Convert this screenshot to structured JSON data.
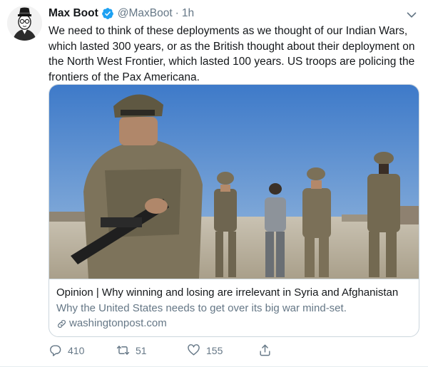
{
  "tweet": {
    "author_name": "Max Boot",
    "handle": "@MaxBoot",
    "separator": "·",
    "time": "1h",
    "text_lines": [
      "We need to think of these deployments as we thought of our Indian Wars,",
      "which lasted 300 years, or as the British thought about their deployment on",
      "the North West Frontier, which lasted 100 years. US troops are policing the",
      "frontiers of the Pax Americana."
    ]
  },
  "card": {
    "title": "Opinion | Why winning and losing are irrelevant in Syria and Afghanistan",
    "description": "Why the United States needs to get over its big war mind-set.",
    "domain": "washingtonpost.com",
    "image_icon": "soldiers-photo"
  },
  "actions": {
    "reply_count": "410",
    "retweet_count": "51",
    "like_count": "155"
  },
  "icons": {
    "avatar": "avatar-icon",
    "verified": "verified-badge-icon",
    "caret": "chevron-down-icon",
    "link": "link-icon",
    "reply": "reply-icon",
    "retweet": "retweet-icon",
    "like": "heart-icon",
    "share": "share-icon"
  },
  "colors": {
    "text": "#14171a",
    "secondary": "#657786",
    "verified": "#1da1f2",
    "border": "#ccd6dd"
  }
}
